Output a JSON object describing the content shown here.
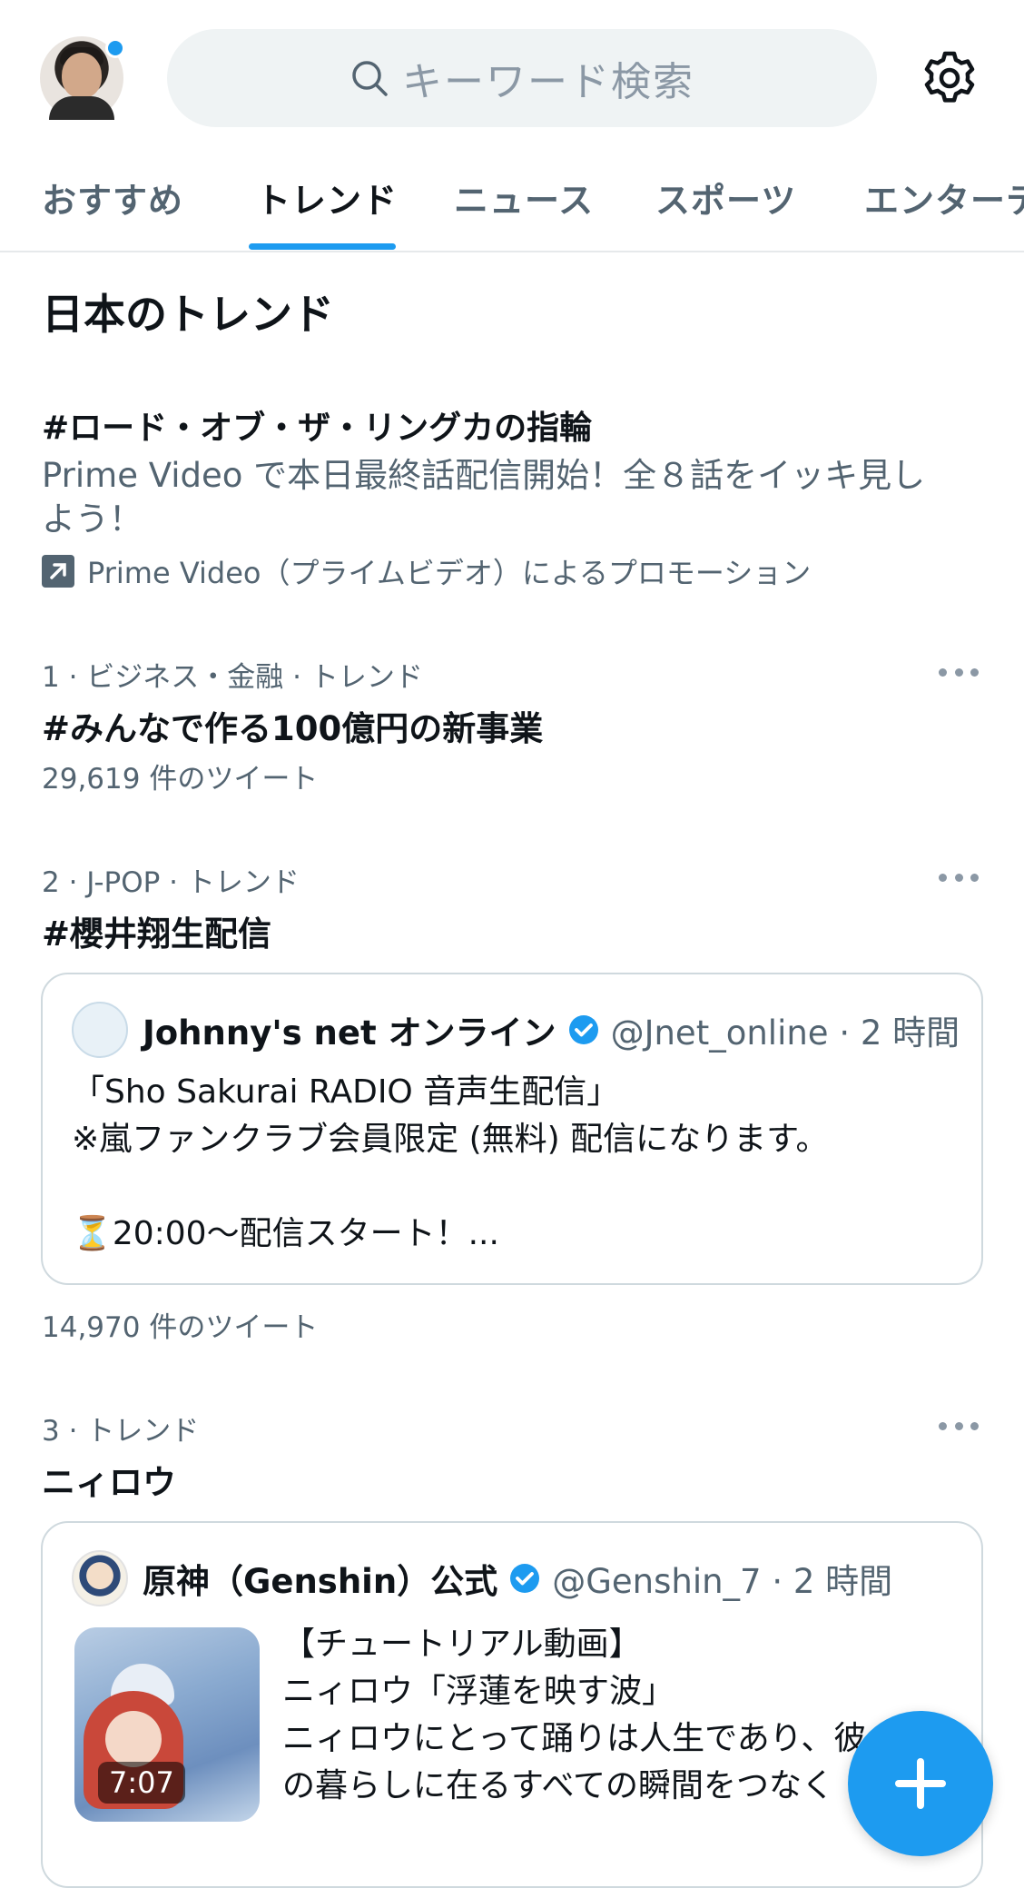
{
  "header": {
    "search_placeholder": "キーワード検索",
    "icons": {
      "search": "search-icon",
      "settings": "gear-icon",
      "avatar": "user-avatar"
    },
    "accent_color": "#1d9bf0"
  },
  "tabs": [
    {
      "label": "おすすめ",
      "active": false
    },
    {
      "label": "トレンド",
      "active": true
    },
    {
      "label": "ニュース",
      "active": false
    },
    {
      "label": "スポーツ",
      "active": false
    },
    {
      "label": "エンターテ",
      "active": false
    }
  ],
  "section_title": "日本のトレンド",
  "promoted": {
    "title": "#ロード・オブ・ザ・リングカの指輪",
    "description": "Prime Video で本日最終話配信開始！全８話をイッキ見しよう！",
    "promoted_by": "Prime Video（プライムビデオ）によるプロモーション"
  },
  "trends": [
    {
      "meta": "1 · ビジネス・金融 · トレンド",
      "name": "#みんなで作る100億円の新事業",
      "count": "29,619 件のツイート"
    },
    {
      "meta": "2 · J-POP · トレンド",
      "name": "#櫻井翔生配信",
      "tweet": {
        "account_name": "Johnny's net オンライン",
        "handle_time": "@Jnet_online · 2 時間",
        "lines": [
          "「Sho Sakurai RADIO 音声生配信」",
          "※嵐ファンクラブ会員限定 (無料) 配信になります。",
          "",
          "⏳20:00〜配信スタート！..."
        ]
      },
      "count": "14,970 件のツイート"
    },
    {
      "meta": "3 · トレンド",
      "name": "ニィロウ",
      "tweet": {
        "account_name": "原神（Genshin）公式",
        "handle_time": "@Genshin_7 · 2 時間",
        "lines": [
          "【チュートリアル動画】",
          "ニィロウ「浮蓮を映す波」",
          "ニィロウにとって踊りは人生であり、彼",
          "の暮らしに在るすべての瞬間をつなく"
        ],
        "video_duration": "7:07"
      }
    }
  ],
  "fab_icon": "plus-icon"
}
